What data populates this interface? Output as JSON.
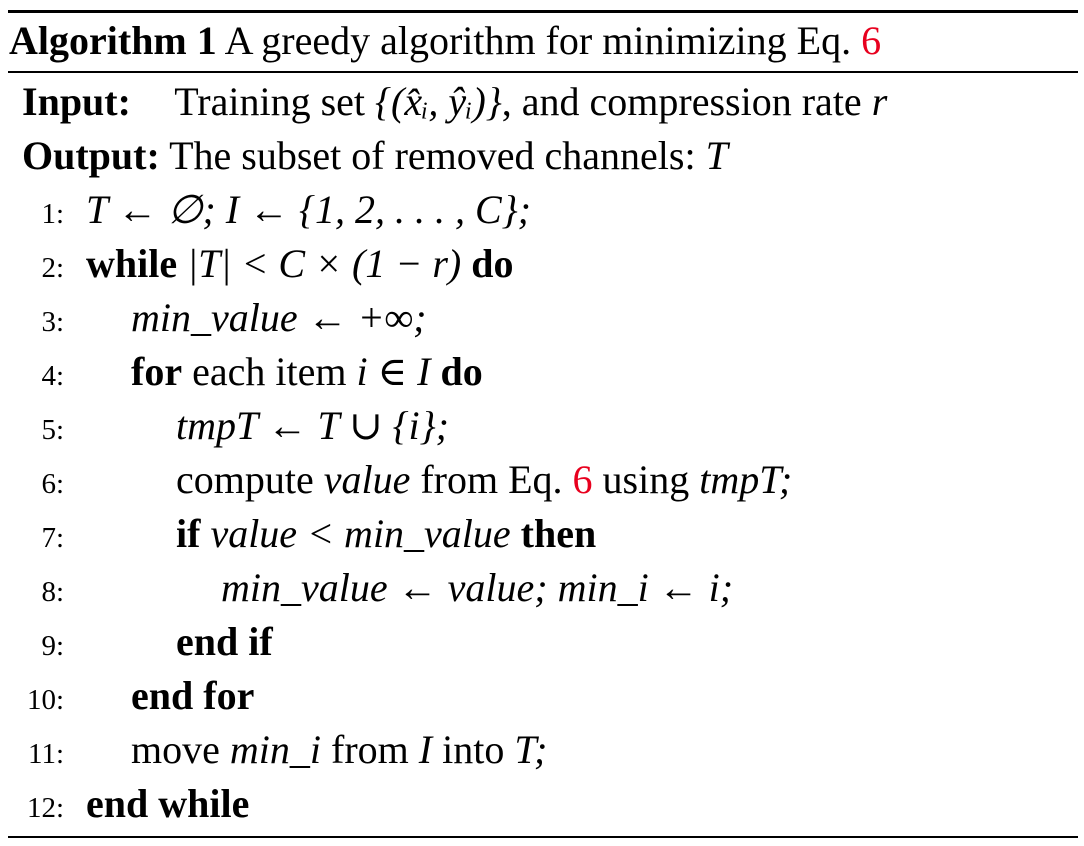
{
  "caption": {
    "label": "Algorithm 1",
    "text": "A greedy algorithm for minimizing Eq.",
    "ref": "6"
  },
  "input": {
    "keyword": "Input:",
    "prefix": "Training set",
    "set_expr": "{(x̂ᵢ, ŷᵢ)}",
    "suffix": ", and compression rate",
    "var": "r"
  },
  "output": {
    "keyword": "Output:",
    "text": "The subset of removed channels:",
    "var": "T"
  },
  "lines": [
    {
      "num": "1:",
      "expr": "T ← ∅; I ← {1, 2, . . . , C};"
    },
    {
      "num": "2:",
      "kw_start": "while",
      "expr": "|T| < C × (1 − r)",
      "kw_end": "do"
    },
    {
      "num": "3:",
      "var": "min_value",
      "expr": "← +∞;"
    },
    {
      "num": "4:",
      "kw_start": "for",
      "text": "each item",
      "expr": "i ∈ I",
      "kw_end": "do"
    },
    {
      "num": "5:",
      "expr": "tmpT ← T ∪ {i};"
    },
    {
      "num": "6:",
      "text1": "compute",
      "var1": "value",
      "text2": "from Eq.",
      "ref": "6",
      "text3": "using",
      "var2": "tmpT;"
    },
    {
      "num": "7:",
      "kw_start": "if",
      "expr": "value < min_value",
      "kw_end": "then"
    },
    {
      "num": "8:",
      "expr": "min_value ← value; min_i ← i;"
    },
    {
      "num": "9:",
      "kw": "end if"
    },
    {
      "num": "10:",
      "kw": "end for"
    },
    {
      "num": "11:",
      "text1": "move",
      "var1": "min_i",
      "text2": "from",
      "var2": "I",
      "text3": "into",
      "var3": "T;"
    },
    {
      "num": "12:",
      "kw": "end while"
    }
  ]
}
